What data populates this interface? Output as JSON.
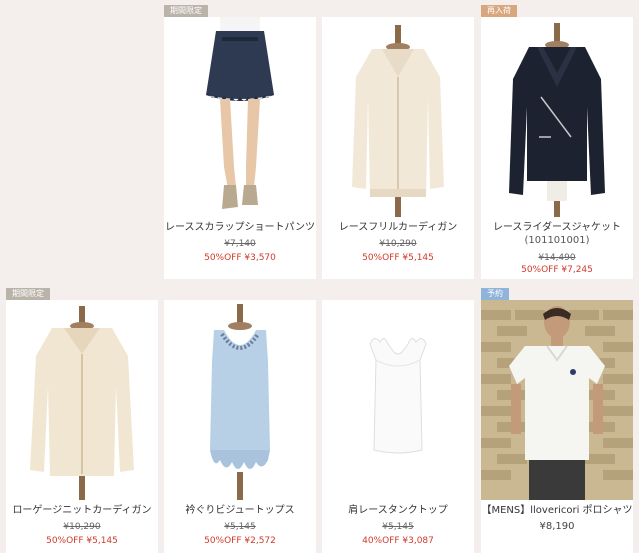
{
  "colors": {
    "sale": "#d23a2a",
    "badge_gray": "#b9b3aa",
    "badge_tan": "#d9a77f",
    "badge_blue": "#8fb3d9"
  },
  "products": [
    {
      "badge": "期間限定",
      "badge_color": "#b9b3aa",
      "name": "レーススカラップショートパンツ",
      "old_price": "¥7,140",
      "sale_price": "50%OFF ¥3,570",
      "image": "lace-shorts-photo"
    },
    {
      "name": "レースフリルカーディガン",
      "old_price": "¥10,290",
      "sale_price": "50%OFF ¥5,145",
      "image": "lace-cardigan-photo"
    },
    {
      "badge": "再入荷",
      "badge_color": "#d9a77f",
      "name": "レースライダースジャケット",
      "code": "(101101001)",
      "old_price": "¥14,490",
      "sale_price": "50%OFF ¥7,245",
      "image": "rider-jacket-photo"
    },
    {
      "badge": "期間限定",
      "badge_color": "#b9b3aa",
      "name": "ローゲージニットカーディガン",
      "old_price": "¥10,290",
      "sale_price": "50%OFF ¥5,145",
      "image": "knit-cardigan-photo"
    },
    {
      "name": "衿ぐりビジュートップス",
      "old_price": "¥5,145",
      "sale_price": "50%OFF ¥2,572",
      "image": "bijou-top-photo"
    },
    {
      "name": "肩レースタンクトップ",
      "old_price": "¥5,145",
      "sale_price": "40%OFF ¥3,087",
      "image": "tank-top-photo"
    },
    {
      "badge": "予約",
      "badge_color": "#8fb3d9",
      "name": "【MENS】llovericori ポロシャツ",
      "price": "¥8,190",
      "image": "polo-shirt-photo"
    }
  ]
}
